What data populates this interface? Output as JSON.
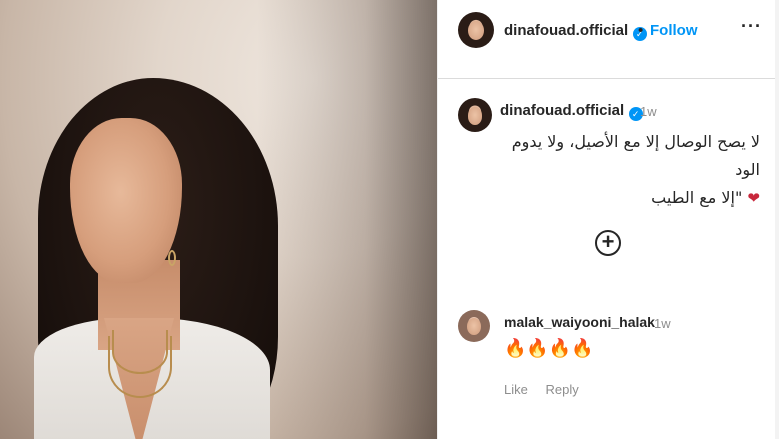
{
  "post": {
    "author": "dinafouad.official",
    "follow_label": "Follow",
    "separator": "•",
    "more_label": "···",
    "caption": {
      "author": "dinafouad.official",
      "time": "1w",
      "text": "لا يصح الوصال إلا مع الأصيل، ولا يدوم الود\n❤️‍🩹 \"إلا مع الطيب"
    },
    "load_more_label": "+"
  },
  "comments": [
    {
      "author": "malak_waiyooni_halak",
      "time": "1w",
      "text": "🔥🔥🔥🔥",
      "like_label": "Like",
      "reply_label": "Reply"
    }
  ],
  "icons": {
    "verified": "verified-badge-icon",
    "more": "more-options-icon",
    "load_more": "plus-circle-icon"
  },
  "colors": {
    "accent": "#0095f6",
    "muted": "#8e8e8e",
    "text": "#262626"
  }
}
